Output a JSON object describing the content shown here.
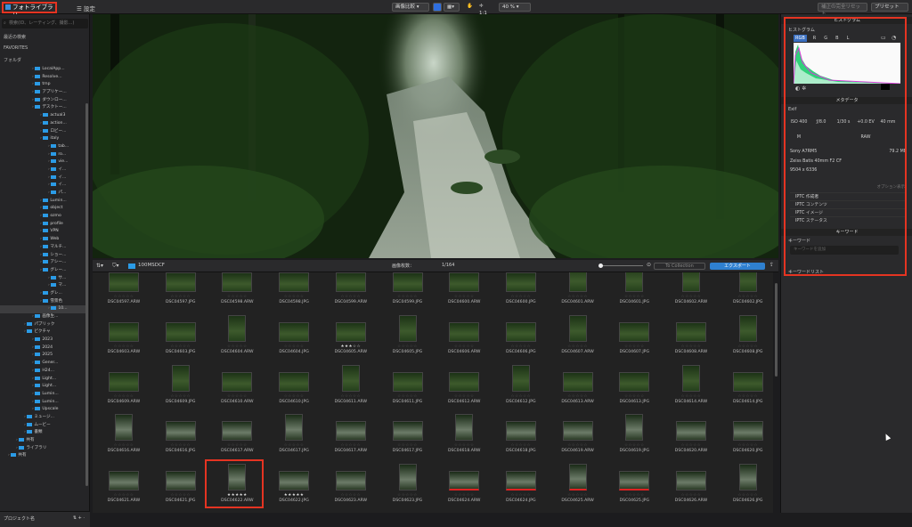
{
  "top": {
    "library_tab": "フォトライブラリ",
    "settings_tab": "設定",
    "compare": "画像比較",
    "zoom_fit": "1:1",
    "zoom_level": "40 %",
    "reset_btn": "補正の完全リセット",
    "preset_btn": "プリセット"
  },
  "left": {
    "search_placeholder": "検索(ID、レーティング、撮影...)",
    "recent": "最近の検索",
    "favorites": "FAVORITES",
    "folders": "フォルダ",
    "tree": [
      {
        "label": "LocalApp...",
        "depth": 4
      },
      {
        "label": "Resolve...",
        "depth": 4
      },
      {
        "label": "tmp",
        "depth": 4
      },
      {
        "label": "アプリケー...",
        "depth": 4
      },
      {
        "label": "ダウンロー...",
        "depth": 4
      },
      {
        "label": "デスクトー...",
        "depth": 4
      },
      {
        "label": "actual3",
        "depth": 5
      },
      {
        "label": "action...",
        "depth": 5
      },
      {
        "label": "ロビー...",
        "depth": 5
      },
      {
        "label": "italy",
        "depth": 5
      },
      {
        "label": "tab...",
        "depth": 6
      },
      {
        "label": "ro...",
        "depth": 6
      },
      {
        "label": "vie...",
        "depth": 6
      },
      {
        "label": "イ...",
        "depth": 6
      },
      {
        "label": "イ...",
        "depth": 6
      },
      {
        "label": "イ...",
        "depth": 6
      },
      {
        "label": "パ...",
        "depth": 6
      },
      {
        "label": "Lumin...",
        "depth": 5
      },
      {
        "label": "object",
        "depth": 5
      },
      {
        "label": "ozmo",
        "depth": 5
      },
      {
        "label": "profile",
        "depth": 5
      },
      {
        "label": "VPN",
        "depth": 5
      },
      {
        "label": "Web",
        "depth": 5
      },
      {
        "label": "マルチ...",
        "depth": 5
      },
      {
        "label": "ショー...",
        "depth": 5
      },
      {
        "label": "アシー...",
        "depth": 5
      },
      {
        "label": "グレー...",
        "depth": 5
      },
      {
        "label": "サ...",
        "depth": 6
      },
      {
        "label": "マ...",
        "depth": 6
      },
      {
        "label": "グレ...",
        "depth": 5
      },
      {
        "label": "雪景色",
        "depth": 5
      },
      {
        "label": "10...",
        "depth": 6,
        "selected": true
      },
      {
        "label": "画像生...",
        "depth": 4
      },
      {
        "label": "パブリック",
        "depth": 3
      },
      {
        "label": "ピクチャ",
        "depth": 3
      },
      {
        "label": "2023",
        "depth": 4
      },
      {
        "label": "2024",
        "depth": 4
      },
      {
        "label": "2025",
        "depth": 4
      },
      {
        "label": "Gener...",
        "depth": 4
      },
      {
        "label": "H24...",
        "depth": 4
      },
      {
        "label": "Light...",
        "depth": 4
      },
      {
        "label": "Light...",
        "depth": 4
      },
      {
        "label": "Lumin...",
        "depth": 4
      },
      {
        "label": "Lumin...",
        "depth": 4
      },
      {
        "label": "Upscale",
        "depth": 4
      },
      {
        "label": "ミュージ...",
        "depth": 3
      },
      {
        "label": "ムービー",
        "depth": 3
      },
      {
        "label": "書類",
        "depth": 3
      },
      {
        "label": "共有",
        "depth": 2
      },
      {
        "label": "ライブラリ",
        "depth": 2
      },
      {
        "label": "共有",
        "depth": 1
      }
    ],
    "projects": "プロジェクト名"
  },
  "filmstrip_bar": {
    "folder": "100MSDCF",
    "count_label": "画像枚数：",
    "count": "1/164",
    "collection": "To Collection",
    "export": "エクスポート"
  },
  "grid": {
    "rows": [
      [
        "DSC04597.ARW",
        "DSC04597.JPG",
        "DSC04598.ARW",
        "DSC04598.JPG",
        "DSC04599.ARW",
        "DSC04599.JPG",
        "DSC04600.ARW",
        "DSC04600.JPG",
        "DSC04601.ARW",
        "DSC04601.JPG",
        "DSC04602.ARW",
        "DSC04602.JPG"
      ],
      [
        "DSC04603.ARW",
        "DSC04603.JPG",
        "DSC04604.ARW",
        "DSC04604.JPG",
        "DSC04605.ARW",
        "DSC04605.JPG",
        "DSC04606.ARW",
        "DSC04606.JPG",
        "DSC04607.ARW",
        "DSC04607.JPG",
        "DSC04608.ARW",
        "DSC04608.JPG"
      ],
      [
        "DSC04609.ARW",
        "DSC04609.JPG",
        "DSC04610.ARW",
        "DSC04610.JPG",
        "DSC04611.ARW",
        "DSC04611.JPG",
        "DSC04612.ARW",
        "DSC04612.JPG",
        "DSC04613.ARW",
        "DSC04613.JPG",
        "DSC04614.ARW",
        "DSC04614.JPG"
      ],
      [
        "DSC04616.ARW",
        "DSC04616.JPG",
        "DSC04617.ARW",
        "DSC04617.JPG",
        "DSC04617.ARW",
        "DSC04617.JPG",
        "DSC04618.ARW",
        "DSC04618.JPG",
        "DSC04619.ARW",
        "DSC04619.JPG",
        "DSC04620.ARW",
        "DSC04620.JPG"
      ],
      [
        "DSC04621.ARW",
        "DSC04621.JPG",
        "DSC04622.ARW",
        "DSC04622.JPG",
        "DSC04623.ARW",
        "DSC04623.JPG",
        "DSC04624.ARW",
        "DSC04624.JPG",
        "DSC04625.ARW",
        "DSC04625.JPG",
        "DSC04626.ARW",
        "DSC04626.JPG"
      ]
    ],
    "stars_empty": "☆☆☆☆☆",
    "stars_five": "★★★★★",
    "stars_three": "★★★☆☆"
  },
  "right": {
    "histogram_header": "ヒストグラム",
    "histogram_sub": "ヒストグラム",
    "channels": [
      "RGB",
      "R",
      "G",
      "B",
      "L"
    ],
    "metadata_header": "メタデータ",
    "exif_label": "Exif",
    "exif_row1": [
      "ISO 400",
      "ƒ/8.0",
      "1/30 s",
      "+0.0 EV",
      "40 mm"
    ],
    "exif_row2": [
      "M",
      "",
      "",
      "RAW",
      ""
    ],
    "camera": "Sony A7RM5",
    "file_size": "79.2 MB",
    "lens": "Zeiss Batis 40mm F2 CF",
    "dimensions": "9504 x 6336",
    "option_label": "オプション表示",
    "iptc": [
      "IPTC 作成者",
      "IPTC コンテンツ",
      "IPTC イメージ",
      "IPTC ステータス"
    ],
    "keyword_header": "キーワード",
    "keyword_label": "キーワード",
    "keyword_placeholder": "キーワードを追加",
    "keyword_list": "キーワードリスト"
  }
}
